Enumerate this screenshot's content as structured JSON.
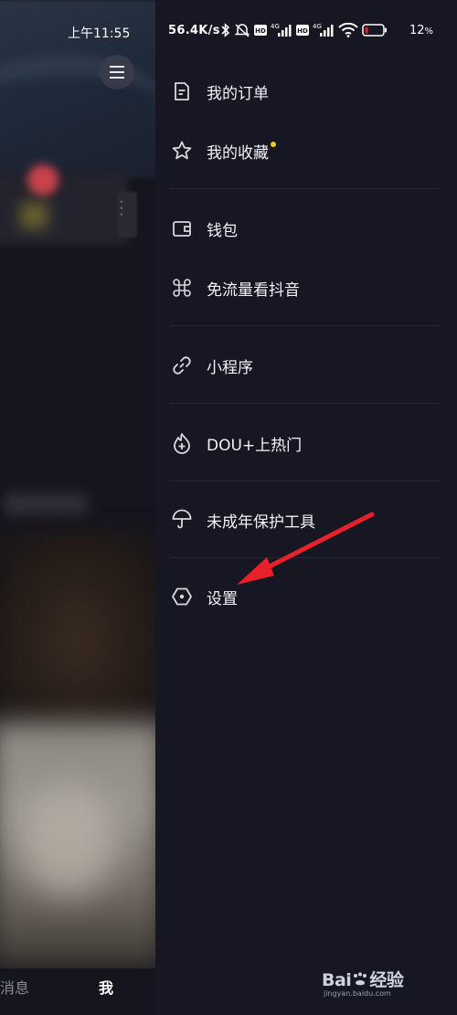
{
  "status_bar": {
    "time": "上午11:55",
    "net_speed": "56.4K/s",
    "battery": "12",
    "battery_unit": "%",
    "icons": [
      "bluetooth-icon",
      "mute-icon",
      "hd-icon",
      "signal-4g-icon",
      "hd-icon",
      "signal-4g-icon",
      "wifi-icon",
      "battery-icon"
    ]
  },
  "drawer": {
    "items": [
      {
        "label": "我的订单",
        "icon": "order-icon"
      },
      {
        "label": "我的收藏",
        "icon": "star-icon",
        "has_badge": true
      },
      {
        "label": "钱包",
        "icon": "wallet-icon"
      },
      {
        "label": "免流量看抖音",
        "icon": "free-data-icon"
      },
      {
        "label": "小程序",
        "icon": "mini-program-icon"
      },
      {
        "label": "DOU+上热门",
        "icon": "dou-plus-icon"
      },
      {
        "label": "未成年保护工具",
        "icon": "umbrella-icon"
      },
      {
        "label": "设置",
        "icon": "settings-icon"
      }
    ]
  },
  "bottom_nav": {
    "messages": "消息",
    "me": "我"
  },
  "watermark": {
    "brand": "Bai",
    "brand_cn": "经验",
    "domain": "jingyan.baidu.com"
  },
  "colors": {
    "drawer_bg": "#161722",
    "badge": "#f5c518",
    "arrow": "#e8202a"
  }
}
